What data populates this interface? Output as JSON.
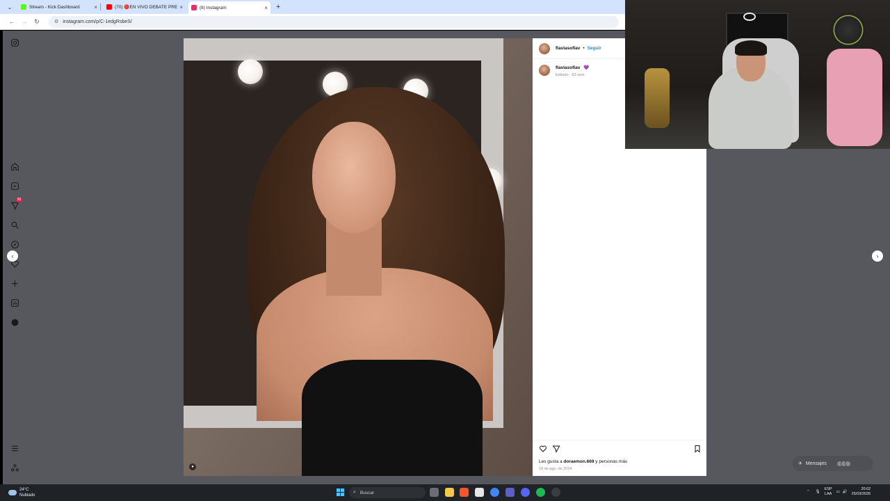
{
  "browser": {
    "tabs": [
      {
        "label": "Stream - Kick Dashboard",
        "favicon_color": "#53fc18",
        "active": false
      },
      {
        "label": "(70) 🔴EN VIVO DEBATE PRESI",
        "favicon_color": "#ff0000",
        "active": false
      },
      {
        "label": "(8) Instagram",
        "favicon_color": "#e1306c",
        "active": true
      }
    ],
    "tab_menu_icon": "chevron-down-icon",
    "new_tab_label": "+",
    "close_label": "×",
    "url": "instagram.com/p/C-1edgRsbeS/"
  },
  "sidebar": {
    "notification_count": "99"
  },
  "post": {
    "username": "flaviasofiav",
    "separator": "•",
    "follow_label": "Seguir",
    "caption_username": "flaviasofiav",
    "caption_emoji": "💜",
    "caption_meta": "Editado · 83 sem",
    "likes_prefix": "Les gusta a ",
    "likes_user": "doraemon.669",
    "likes_suffix": " y personas más",
    "date": "18 de ago. de 2024"
  },
  "messages": {
    "label": "Mensajes",
    "badge": "9"
  },
  "taskbar": {
    "weather_temp": "24°C",
    "weather_desc": "Nublado",
    "search_placeholder": "Buscar",
    "lang_line1": "ESP",
    "lang_line2": "LAA",
    "time": "20:02",
    "date": "25/03/2026"
  },
  "colors": {
    "accent_follow": "#0095f6",
    "page_background": "#56585d",
    "notification_badge": "#e02047"
  }
}
